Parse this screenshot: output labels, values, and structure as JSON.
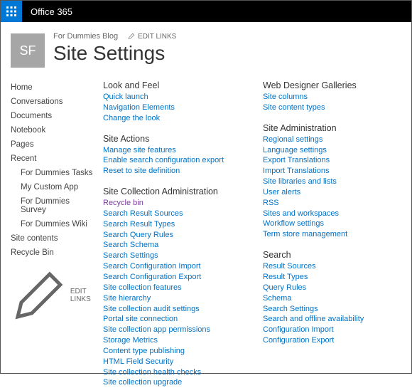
{
  "topbar": {
    "brand": "Office 365"
  },
  "header": {
    "logo_text": "SF",
    "crumb": "For Dummies Blog",
    "edit_links": "EDIT LINKS",
    "title": "Site Settings"
  },
  "leftnav": {
    "items": [
      {
        "label": "Home"
      },
      {
        "label": "Conversations"
      },
      {
        "label": "Documents"
      },
      {
        "label": "Notebook"
      },
      {
        "label": "Pages"
      },
      {
        "label": "Recent"
      },
      {
        "label": "For Dummies Tasks",
        "sub": true
      },
      {
        "label": "My Custom App",
        "sub": true
      },
      {
        "label": "For Dummies Survey",
        "sub": true
      },
      {
        "label": "For Dummies Wiki",
        "sub": true
      },
      {
        "label": "Site contents"
      },
      {
        "label": "Recycle Bin"
      }
    ],
    "edit_links": "EDIT LINKS"
  },
  "col1": {
    "sections": [
      {
        "head": "Look and Feel",
        "links": [
          "Quick launch",
          "Navigation Elements",
          "Change the look"
        ]
      },
      {
        "head": "Site Actions",
        "links": [
          "Manage site features",
          "Enable search configuration export",
          "Reset to site definition"
        ]
      },
      {
        "head": "Site Collection Administration",
        "links": [
          "Recycle bin",
          "Search Result Sources",
          "Search Result Types",
          "Search Query Rules",
          "Search Schema",
          "Search Settings",
          "Search Configuration Import",
          "Search Configuration Export",
          "Site collection features",
          "Site hierarchy",
          "Site collection audit settings",
          "Portal site connection",
          "Site collection app permissions",
          "Storage Metrics",
          "Content type publishing",
          "HTML Field Security",
          "Site collection health checks",
          "Site collection upgrade"
        ],
        "visited_index": 0
      }
    ]
  },
  "col2": {
    "sections": [
      {
        "head": "Web Designer Galleries",
        "links": [
          "Site columns",
          "Site content types"
        ]
      },
      {
        "head": "Site Administration",
        "links": [
          "Regional settings",
          "Language settings",
          "Export Translations",
          "Import Translations",
          "Site libraries and lists",
          "User alerts",
          "RSS",
          "Sites and workspaces",
          "Workflow settings",
          "Term store management"
        ]
      },
      {
        "head": "Search",
        "links": [
          "Result Sources",
          "Result Types",
          "Query Rules",
          "Schema",
          "Search Settings",
          "Search and offline availability",
          "Configuration Import",
          "Configuration Export"
        ]
      }
    ]
  }
}
